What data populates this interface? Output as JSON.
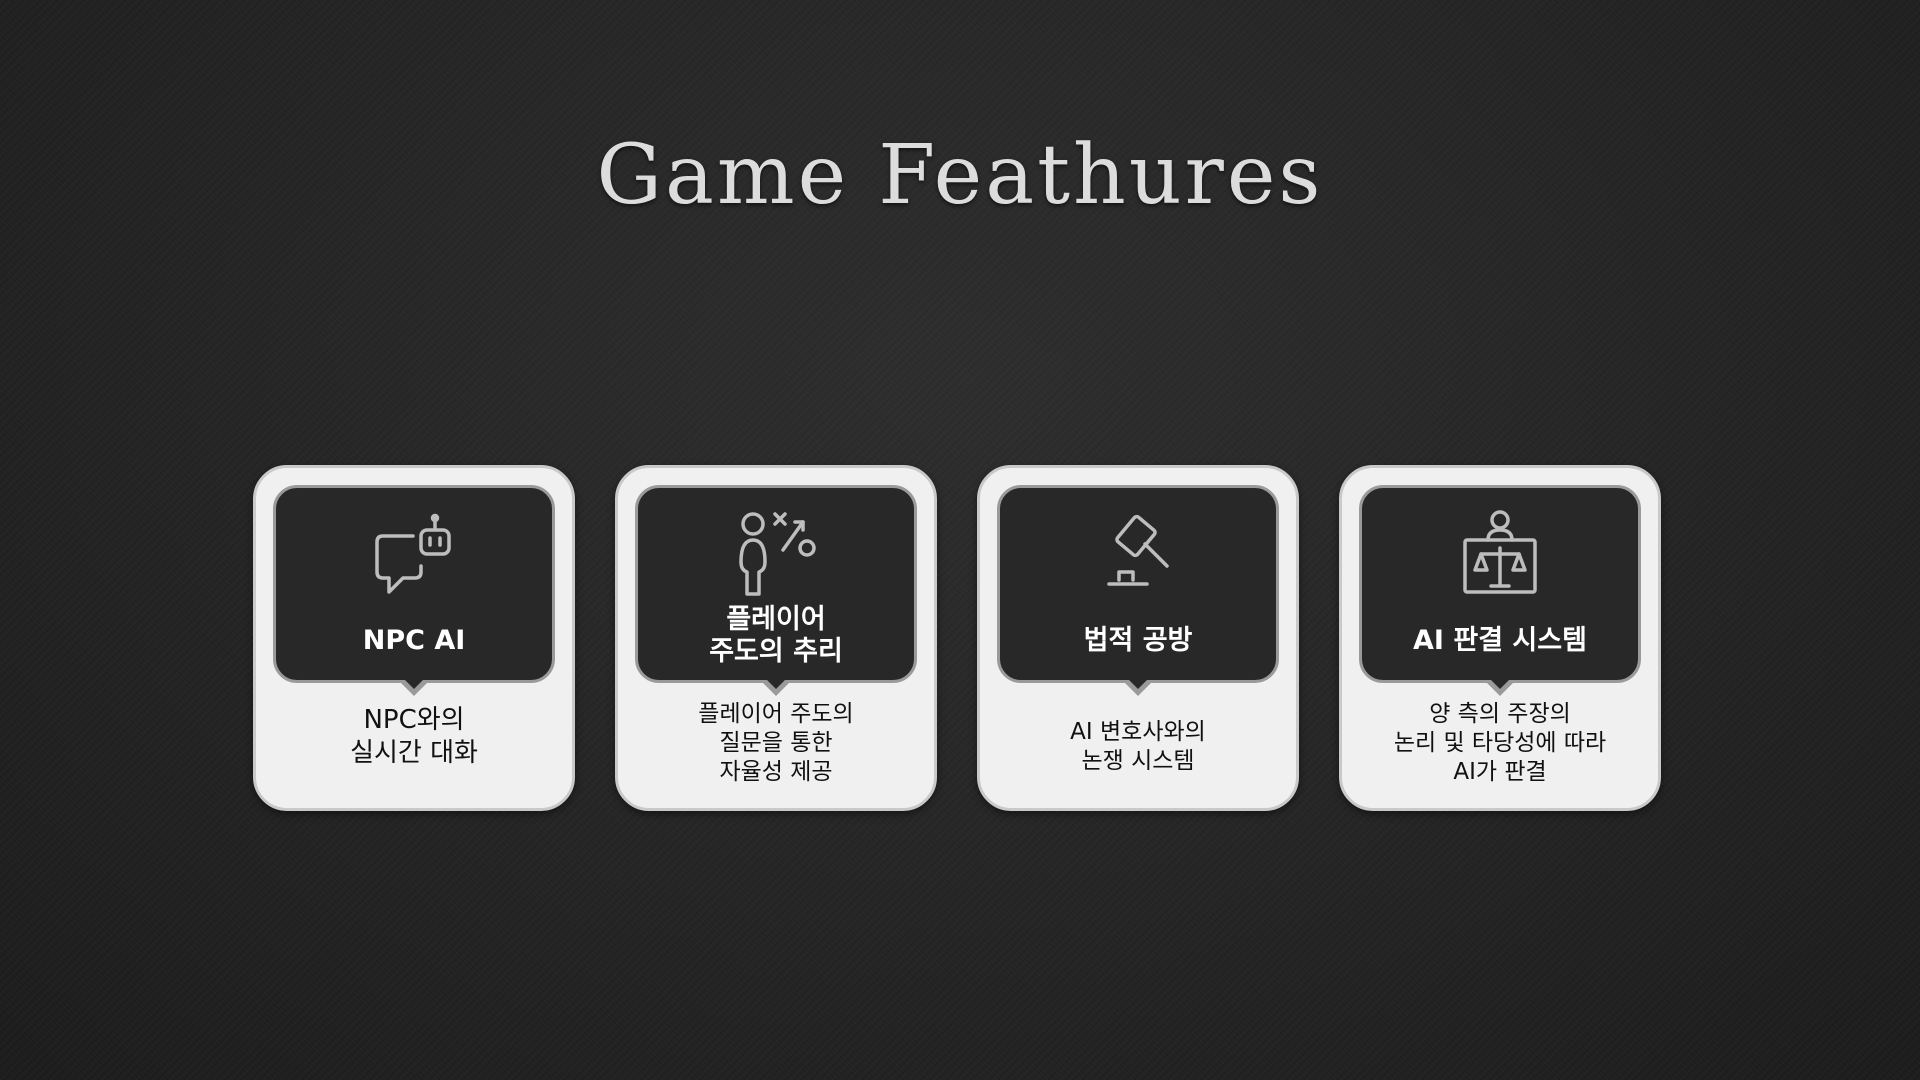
{
  "slide": {
    "title": "Game Feathures"
  },
  "features": [
    {
      "icon": "robot-chat-icon",
      "title": "NPC AI",
      "description": "NPC와의\n실시간 대화"
    },
    {
      "icon": "strategy-play-icon",
      "title": "플레이어\n주도의 추리",
      "description": "플레이어 주도의\n질문을 통한\n자율성 제공"
    },
    {
      "icon": "gavel-icon",
      "title": "법적 공방",
      "description": "AI 변호사와의\n논쟁 시스템"
    },
    {
      "icon": "judge-scales-icon",
      "title": "AI 판결 시스템",
      "description": "양 측의 주장의\n논리 및 타당성에 따라\nAI가 판결"
    }
  ],
  "colors": {
    "background": "#232323",
    "card": "#f0f0f0",
    "panel": "#282828",
    "icon_stroke": "#bdbdbd"
  }
}
